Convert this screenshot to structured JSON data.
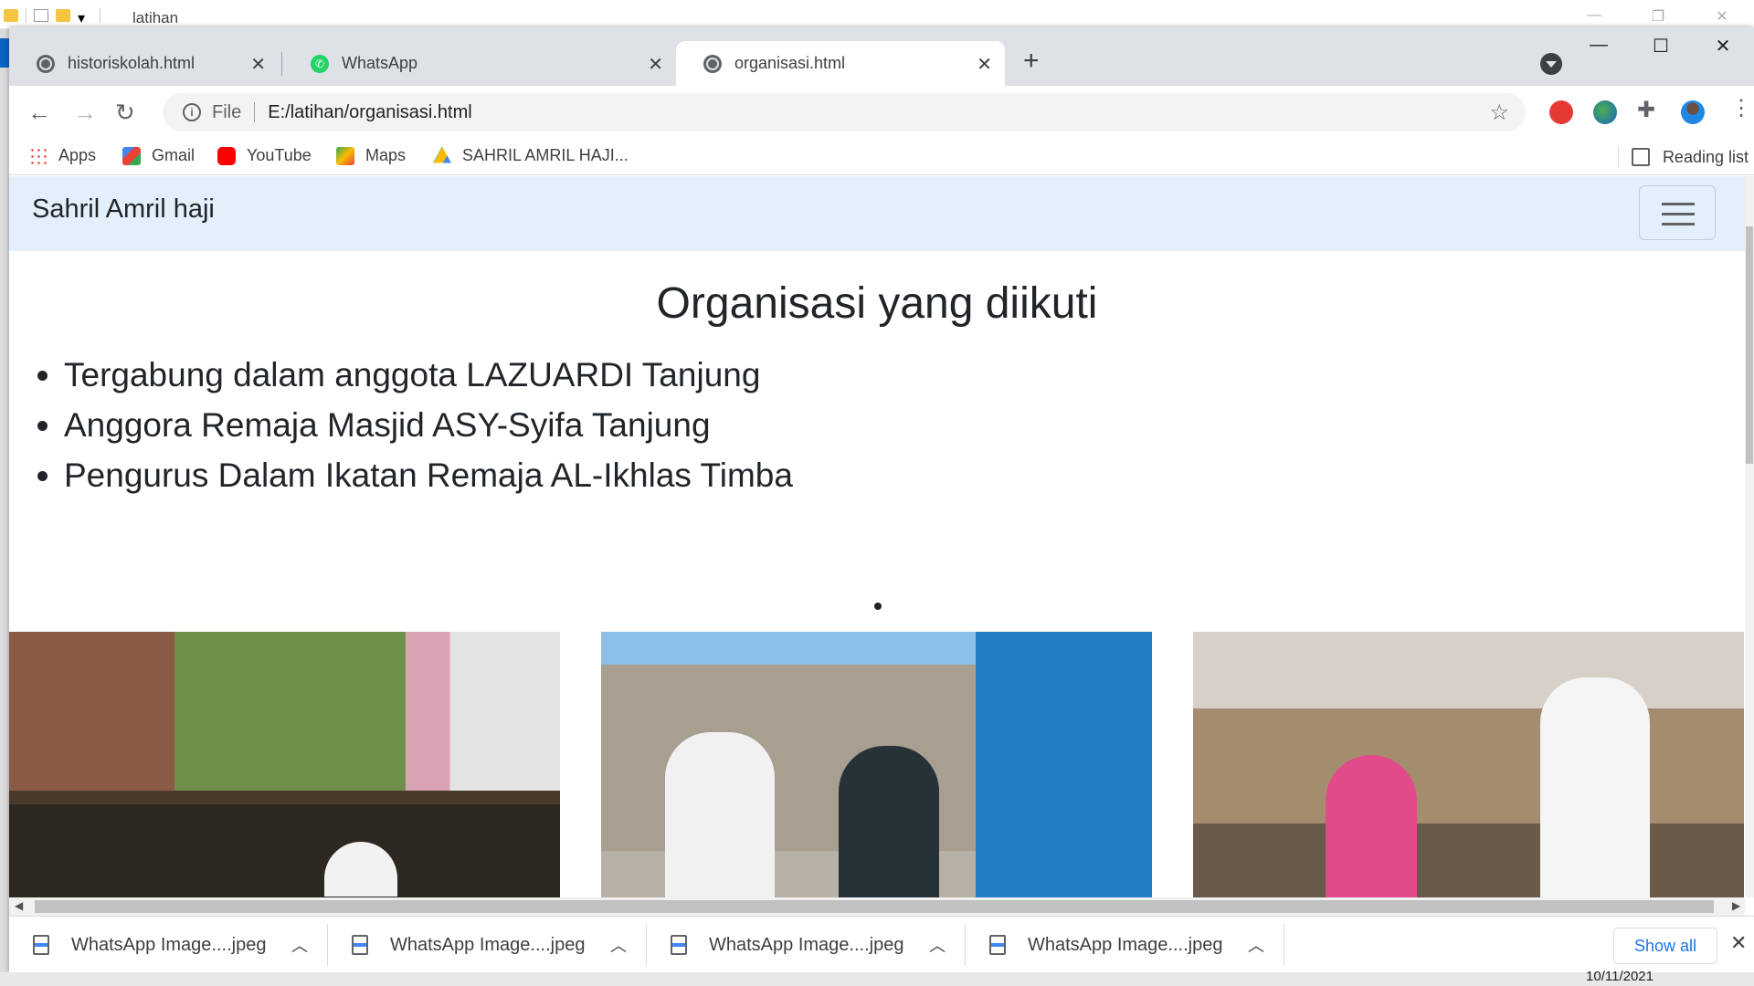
{
  "explorer": {
    "title": "latihan"
  },
  "tabs": [
    {
      "title": "historiskolah.html"
    },
    {
      "title": "WhatsApp"
    },
    {
      "title": "organisasi.html"
    }
  ],
  "window_controls": {
    "minimize": "—",
    "maximize": "☐",
    "close": "✕"
  },
  "toolbar": {
    "scheme_label": "File",
    "url": "E:/latihan/organisasi.html"
  },
  "bookmarks": {
    "items": [
      "Apps",
      "Gmail",
      "YouTube",
      "Maps",
      "SAHRIL AMRIL HAJI..."
    ],
    "reading_list": "Reading list"
  },
  "page": {
    "brand": "Sahril Amril haji",
    "heading": "Organisasi yang diikuti",
    "organizations": [
      "Tergabung dalam anggota LAZUARDI Tanjung",
      "Anggora Remaja Masjid ASY-Syifa Tanjung",
      "Pengurus Dalam Ikatan Remaja AL-Ikhlas Timba"
    ]
  },
  "downloads": {
    "items": [
      "WhatsApp Image....jpeg",
      "WhatsApp Image....jpeg",
      "WhatsApp Image....jpeg",
      "WhatsApp Image....jpeg"
    ],
    "show_all": "Show all"
  },
  "taskbar": {
    "date": "10/11/2021"
  },
  "colors": {
    "navbar_bg": "#e3f0fb",
    "tabstrip_bg": "#dee1e6",
    "link_blue": "#1a73e8"
  }
}
